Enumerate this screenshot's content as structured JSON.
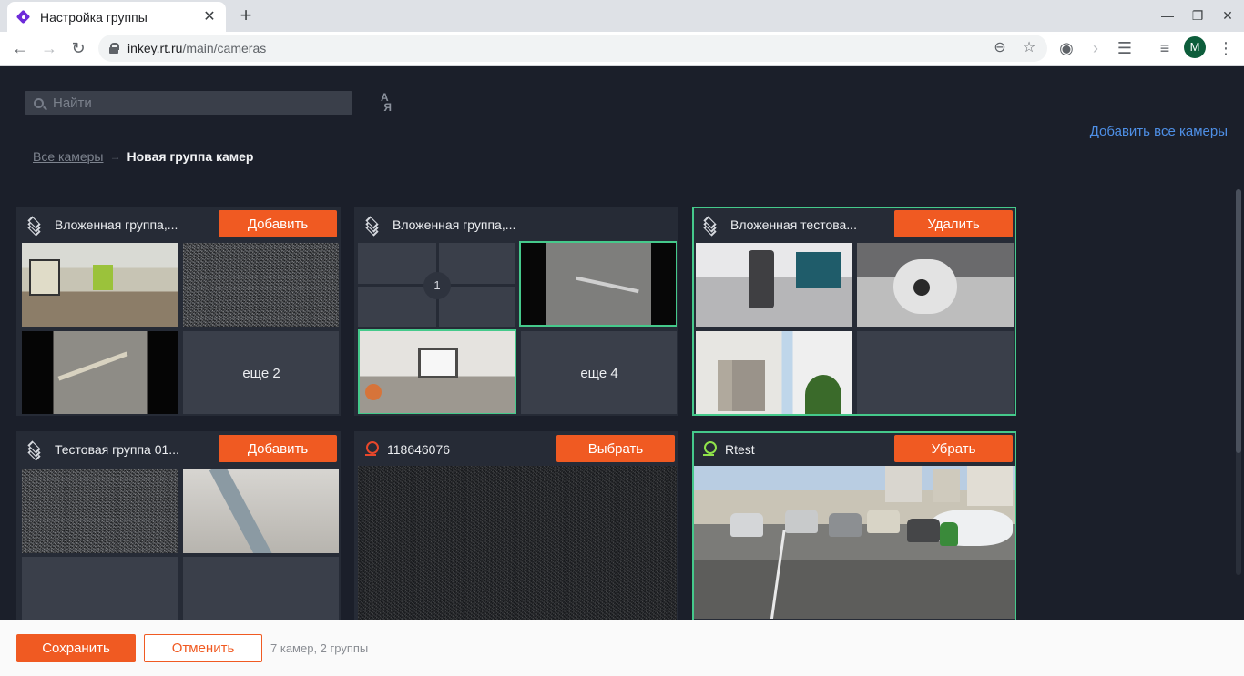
{
  "browser": {
    "tab_title": "Настройка группы",
    "url_host": "inkey.rt.ru",
    "url_path": "/main/cameras",
    "profile_initial": "M"
  },
  "search": {
    "placeholder": "Найти"
  },
  "add_all_label": "Добавить все камеры",
  "breadcrumb": {
    "root": "Все камеры",
    "arrow": "→",
    "current": "Новая группа камер"
  },
  "cards": [
    {
      "title": "Вложенная группа,...",
      "button": "Добавить",
      "more": "еще 2"
    },
    {
      "title": "Вложенная группа,...",
      "badge": "1",
      "more": "еще 4"
    },
    {
      "title": "Вложенная тестова...",
      "button": "Удалить"
    },
    {
      "title": "Тестовая группа 01...",
      "button": "Добавить"
    },
    {
      "title": "118646076",
      "button": "Выбрать"
    },
    {
      "title": "Rtest",
      "button": "Убрать"
    }
  ],
  "footer": {
    "save_label": "Сохранить",
    "cancel_label": "Отменить",
    "summary": "7 камер, 2 группы"
  },
  "colors": {
    "accent": "#f05a22",
    "selected_border": "#45c98b",
    "link": "#4e8fe6",
    "background": "#1b1f2a"
  }
}
